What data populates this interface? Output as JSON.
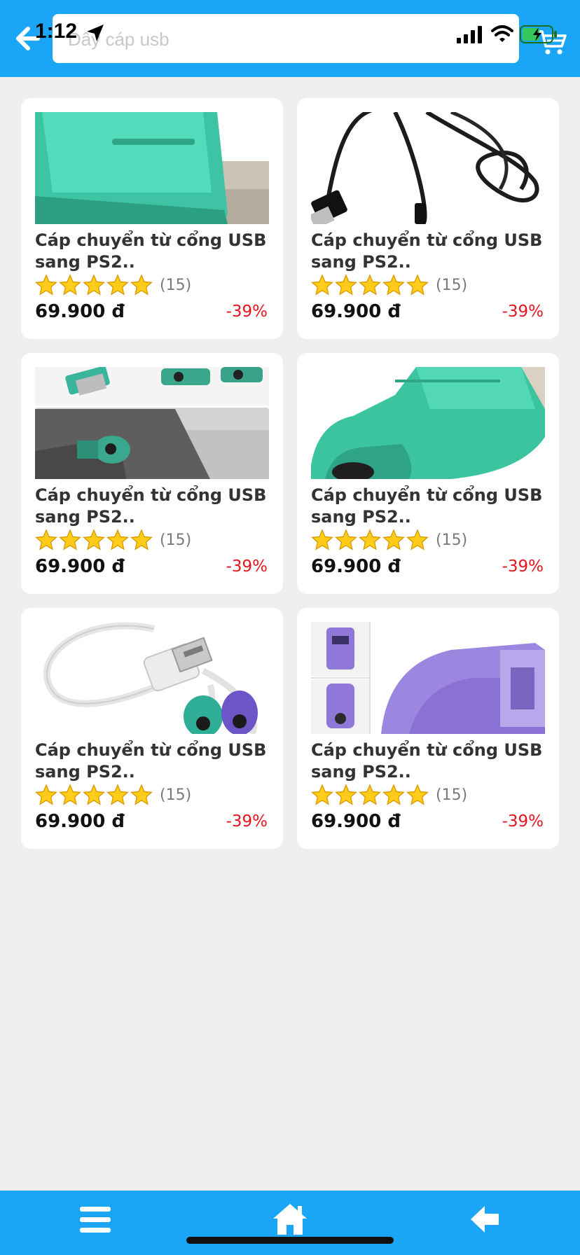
{
  "status_bar": {
    "time": "1:12"
  },
  "header": {
    "search_placeholder": "Dây cáp usb",
    "search_value": ""
  },
  "products": [
    {
      "title_line1": "Cáp chuyển từ cổng USB",
      "title_line2": "sang PS2..",
      "rating_count": "(15)",
      "price": "69.900 đ",
      "discount": "-39%",
      "rating": 5,
      "image_icon": "usb-ps2-adapter-green"
    },
    {
      "title_line1": "Cáp chuyển từ cổng USB",
      "title_line2": "sang PS2..",
      "rating_count": "(15)",
      "price": "69.900 đ",
      "discount": "-39%",
      "rating": 5,
      "image_icon": "usb-cable-black"
    },
    {
      "title_line1": "Cáp chuyển từ cổng USB",
      "title_line2": "sang PS2..",
      "rating_count": "(15)",
      "price": "69.900 đ",
      "discount": "-39%",
      "rating": 5,
      "image_icon": "usb-ps2-adapters-in-pc"
    },
    {
      "title_line1": "Cáp chuyển từ cổng USB",
      "title_line2": "sang PS2..",
      "rating_count": "(15)",
      "price": "69.900 đ",
      "discount": "-39%",
      "rating": 5,
      "image_icon": "usb-ps2-adapter-green-closeup"
    },
    {
      "title_line1": "Cáp chuyển từ cổng USB",
      "title_line2": "sang PS2..",
      "rating_count": "(15)",
      "price": "69.900 đ",
      "discount": "-39%",
      "rating": 5,
      "image_icon": "usb-splitter-cable-white"
    },
    {
      "title_line1": "Cáp chuyển từ cổng USB",
      "title_line2": "sang PS2..",
      "rating_count": "(15)",
      "price": "69.900 đ",
      "discount": "-39%",
      "rating": 5,
      "image_icon": "usb-ps2-adapter-purple"
    }
  ],
  "icons": {
    "back": "arrow-left-icon",
    "cart": "cart-icon",
    "menu": "menu-icon",
    "home": "home-icon",
    "nav_back": "arrow-left-icon"
  },
  "colors": {
    "brand": "#1aa5f7",
    "discount": "#e8141e",
    "star": "#ffcc1a",
    "background": "#efefef"
  }
}
